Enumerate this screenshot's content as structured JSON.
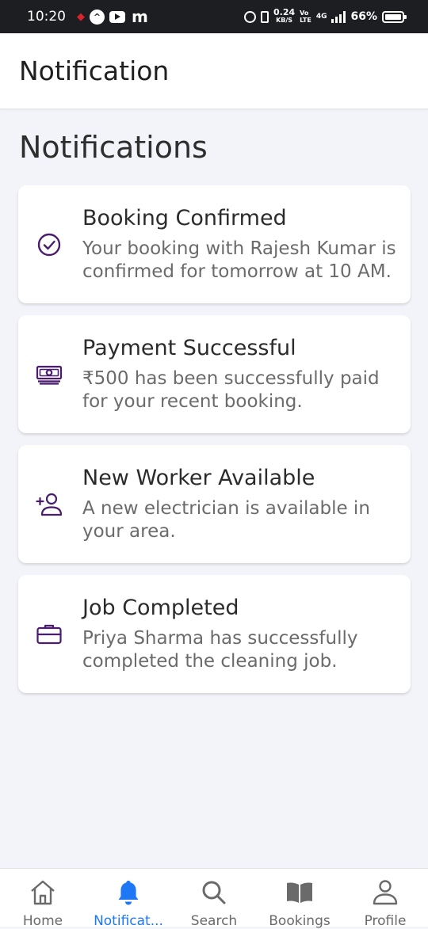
{
  "status_bar": {
    "time": "10:20",
    "app_circle_letter": "^",
    "app_m": "m",
    "speed_value": "0.24",
    "speed_unit": "KB/S",
    "lte_top": "Vo",
    "lte_bottom": "LTE",
    "network": "4G",
    "battery": "66%"
  },
  "header": {
    "title": "Notification"
  },
  "section": {
    "title": "Notifications"
  },
  "accent_color": "#4a1c6e",
  "active_nav_color": "#1e78f5",
  "notifications": [
    {
      "icon": "check-circle-icon",
      "title": "Booking Confirmed",
      "body": "Your booking with Rajesh Kumar is confirmed for tomorrow at 10 AM."
    },
    {
      "icon": "cash-icon",
      "title": "Payment Successful",
      "body": "₹500 has been successfully paid for your recent booking."
    },
    {
      "icon": "add-person-icon",
      "title": "New Worker Available",
      "body": "A new electrician is available in your area."
    },
    {
      "icon": "briefcase-icon",
      "title": "Job Completed",
      "body": "Priya Sharma has successfully completed the cleaning job."
    }
  ],
  "nav": [
    {
      "label": "Home",
      "icon": "home-icon",
      "active": false
    },
    {
      "label": "Notificat...",
      "icon": "bell-icon",
      "active": true
    },
    {
      "label": "Search",
      "icon": "search-icon",
      "active": false
    },
    {
      "label": "Bookings",
      "icon": "book-icon",
      "active": false
    },
    {
      "label": "Profile",
      "icon": "person-icon",
      "active": false
    }
  ]
}
